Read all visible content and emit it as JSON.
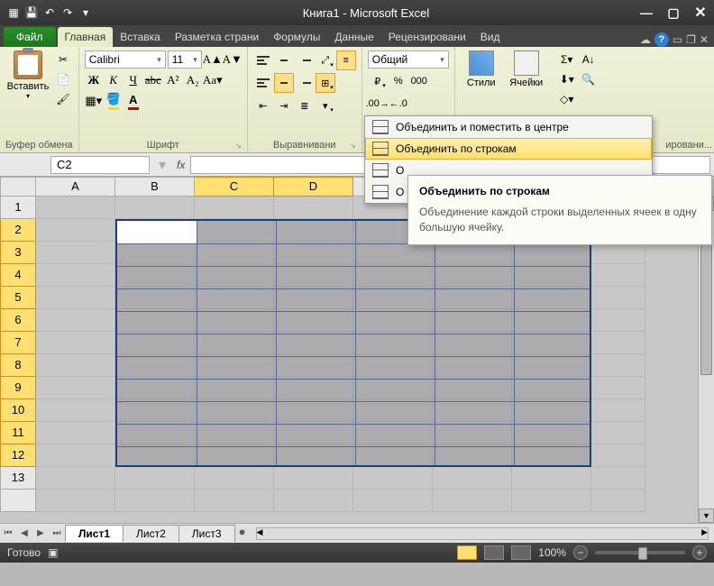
{
  "title": "Книга1 - Microsoft Excel",
  "tabs": {
    "file": "Файл",
    "home": "Главная",
    "insert": "Вставка",
    "layout": "Разметка страни",
    "formulas": "Формулы",
    "data": "Данные",
    "review": "Рецензировани",
    "view": "Вид"
  },
  "ribbon": {
    "clipboard": {
      "paste": "Вставить",
      "label": "Буфер обмена"
    },
    "font": {
      "name": "Calibri",
      "size": "11",
      "label": "Шрифт",
      "bold": "Ж",
      "italic": "К",
      "underline": "Ч"
    },
    "alignment": {
      "label": "Выравнивани"
    },
    "number": {
      "format": "Общий"
    },
    "styles": {
      "label": "Стили"
    },
    "cells": {
      "label": "Ячейки"
    },
    "editing_cut": "ировани..."
  },
  "dropdown": {
    "item1": "Объединить и поместить в центре",
    "item2": "Объединить по строкам",
    "item3_prefix": "О",
    "item4_prefix": "О"
  },
  "tooltip": {
    "title": "Объединить по строкам",
    "body": "Объединение каждой строки выделенных ячеек в одну большую ячейку."
  },
  "namebox": "C2",
  "fx": "fx",
  "columns": [
    "A",
    "B",
    "C",
    "D"
  ],
  "rows": [
    "1",
    "2",
    "3",
    "4",
    "5",
    "6",
    "7",
    "8",
    "9",
    "10",
    "11",
    "12",
    "13"
  ],
  "sheets": {
    "s1": "Лист1",
    "s2": "Лист2",
    "s3": "Лист3"
  },
  "status": {
    "ready": "Готово",
    "zoom": "100%"
  }
}
